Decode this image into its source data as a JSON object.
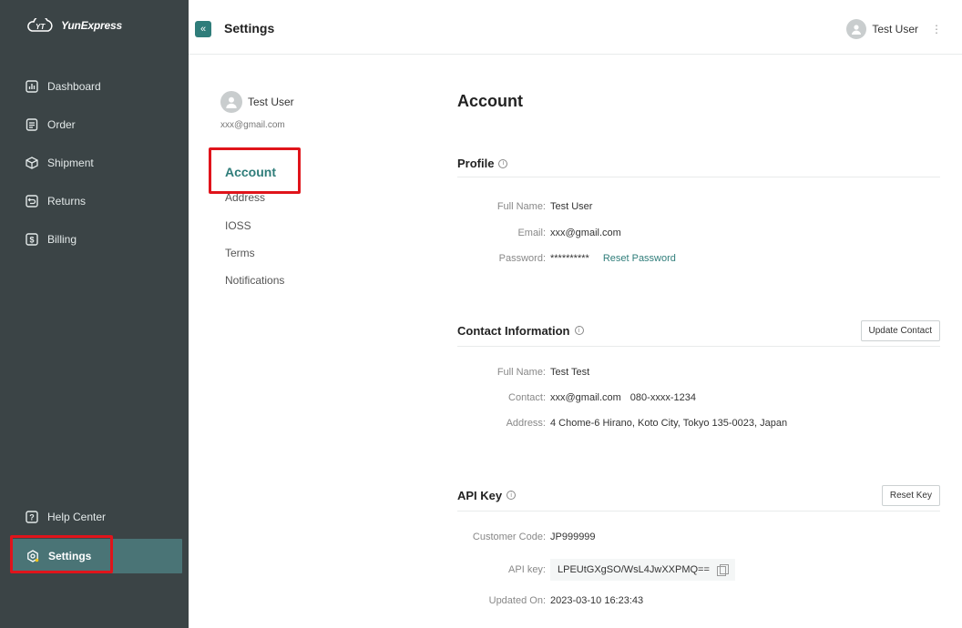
{
  "app": {
    "brand": "YunExpress",
    "header_title": "Settings"
  },
  "sidebar": {
    "items": [
      {
        "label": "Dashboard",
        "icon": "bar-chart-icon"
      },
      {
        "label": "Order",
        "icon": "document-icon"
      },
      {
        "label": "Shipment",
        "icon": "package-icon"
      },
      {
        "label": "Returns",
        "icon": "return-icon"
      },
      {
        "label": "Billing",
        "icon": "dollar-icon"
      }
    ],
    "help": "Help Center",
    "settings": "Settings"
  },
  "header": {
    "user_name": "Test User"
  },
  "settings_nav": {
    "user_name": "Test User",
    "user_email": "xxx@gmail.com",
    "items": [
      "Account",
      "Address",
      "IOSS",
      "Terms",
      "Notifications"
    ]
  },
  "account": {
    "title": "Account",
    "profile": {
      "heading": "Profile",
      "full_name_label": "Full Name:",
      "full_name": "Test User",
      "email_label": "Email:",
      "email": "xxx@gmail.com",
      "password_label": "Password:",
      "password": "**********",
      "reset_password": "Reset Password"
    },
    "contact": {
      "heading": "Contact Information",
      "update_button": "Update Contact",
      "full_name_label": "Full Name:",
      "full_name": "Test Test",
      "contact_label": "Contact:",
      "contact_email": "xxx@gmail.com",
      "contact_phone": "080-xxxx-1234",
      "address_label": "Address:",
      "address": "4 Chome-6 Hirano, Koto City, Tokyo 135-0023, Japan"
    },
    "api": {
      "heading": "API Key",
      "reset_button": "Reset Key",
      "customer_code_label": "Customer Code:",
      "customer_code": "JP999999",
      "api_key_label": "API key:",
      "api_key": "LPEUtGXgSO/WsL4JwXXPMQ==",
      "updated_label": "Updated On:",
      "updated_on": "2023-03-10 16:23:43"
    }
  },
  "colors": {
    "sidebar_bg": "#3b4446",
    "accent": "#2f7d7a",
    "active_item": "#4a7476",
    "highlight": "#e0141b"
  }
}
